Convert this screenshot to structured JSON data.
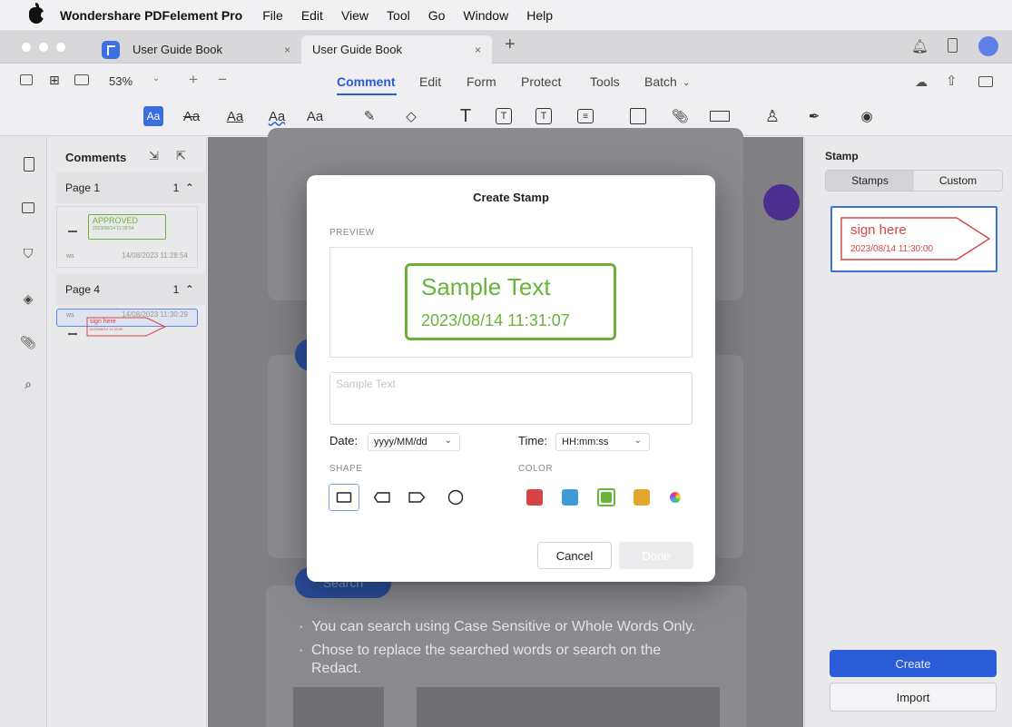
{
  "menubar": {
    "app": "Wondershare PDFelement Pro",
    "items": [
      "File",
      "Edit",
      "View",
      "Tool",
      "Go",
      "Window",
      "Help"
    ]
  },
  "tabs": [
    {
      "label": "User Guide Book"
    },
    {
      "label": "User Guide Book"
    }
  ],
  "tab_close": "×",
  "tab_new": "+",
  "toolbar": {
    "zoom": "53%",
    "tabs": [
      "Comment",
      "Edit",
      "Form",
      "Protect",
      "Tools",
      "Batch"
    ],
    "active_tab": "Comment",
    "text_tools": [
      "Aa",
      "Aa",
      "Aa",
      "Aa",
      "Aa"
    ],
    "icons": [
      "highlight-icon",
      "strikethrough-icon",
      "underline-icon",
      "squiggly-icon",
      "caret-icon",
      "marker-icon",
      "eraser-icon",
      "text-icon",
      "textbox-icon",
      "callout-icon",
      "note-icon",
      "shape-icon",
      "attachment-icon",
      "measure-icon",
      "stamp-icon",
      "signature-icon",
      "eye-icon"
    ]
  },
  "comments_panel": {
    "title": "Comments",
    "pages": [
      {
        "label": "Page 1",
        "count": "1",
        "stamp": "APPROVED",
        "stamp_date": "2023/08/14 11:28:54",
        "author": "ws",
        "date": "14/08/2023 11:28:54"
      },
      {
        "label": "Page 4",
        "count": "1",
        "stamp": "sign here",
        "stamp_date": "2023/08/14 11:30:00",
        "author": "ws",
        "date": "14/08/2023 11:30:29"
      }
    ]
  },
  "document": {
    "bullets": [
      "You can search using Case Sensitive or Whole Words Only.",
      "Chose to replace the searched words or search on the Redact."
    ],
    "search_button": "Search"
  },
  "right_panel": {
    "title": "Stamp",
    "segments": [
      "Stamps",
      "Custom"
    ],
    "active_segment": "Stamps",
    "stamp_text": "sign here",
    "stamp_date": "2023/08/14 11:30:00",
    "create": "Create",
    "import": "Import"
  },
  "modal": {
    "title": "Create Stamp",
    "preview_label": "PREVIEW",
    "preview_text": "Sample Text",
    "preview_date": "2023/08/14 11:31:07",
    "text_placeholder": "Sample Text",
    "date_label": "Date:",
    "date_value": "yyyy/MM/dd",
    "time_label": "Time:",
    "time_value": "HH:mm:ss",
    "shape_label": "SHAPE",
    "color_label": "COLOR",
    "colors": [
      "#d64545",
      "#3e9bd6",
      "#6ab23a",
      "#e3a72d"
    ],
    "selected_color": "#6ab23a",
    "cancel": "Cancel",
    "done": "Done"
  }
}
